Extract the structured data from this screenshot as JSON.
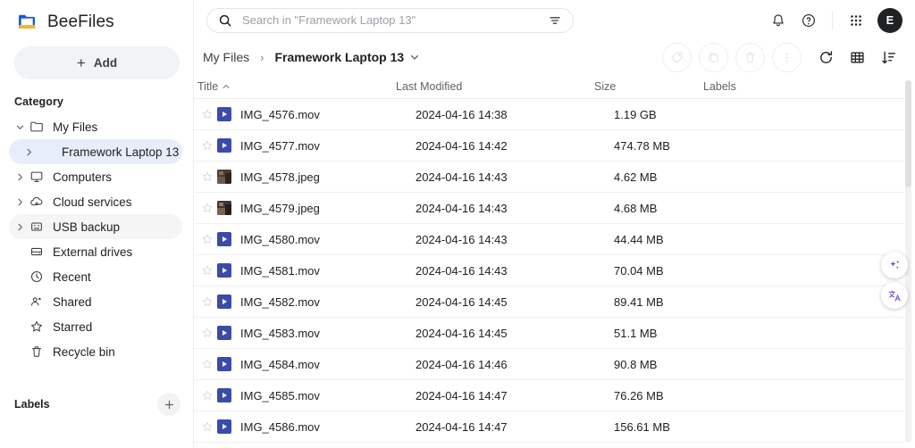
{
  "app": {
    "name": "BeeFiles",
    "logo_icon": "folder-logo-icon"
  },
  "sidebar": {
    "add_button": {
      "label": "Add",
      "icon": "plus-icon"
    },
    "category_title": "Category",
    "items": [
      {
        "label": "My Files",
        "icon": "folder-icon",
        "caret": "chevron-down-icon",
        "state": "expanded"
      },
      {
        "label": "Framework Laptop 13",
        "icon": "",
        "caret": "chevron-right-icon",
        "state": "selected"
      },
      {
        "label": "Computers",
        "icon": "monitor-icon",
        "caret": "chevron-right-icon",
        "state": "normal"
      },
      {
        "label": "Cloud services",
        "icon": "cloud-icon",
        "caret": "chevron-right-icon",
        "state": "normal"
      },
      {
        "label": "USB backup",
        "icon": "usb-drive-icon",
        "caret": "chevron-right-icon",
        "state": "hovered"
      },
      {
        "label": "External drives",
        "icon": "hard-drive-icon",
        "caret": "",
        "state": "normal"
      },
      {
        "label": "Recent",
        "icon": "clock-icon",
        "caret": "",
        "state": "normal"
      },
      {
        "label": "Shared",
        "icon": "people-icon",
        "caret": "",
        "state": "normal"
      },
      {
        "label": "Starred",
        "icon": "star-icon",
        "caret": "",
        "state": "normal"
      },
      {
        "label": "Recycle bin",
        "icon": "trash-icon",
        "caret": "",
        "state": "normal"
      }
    ],
    "labels_title": "Labels",
    "labels_add_icon": "plus-icon"
  },
  "search": {
    "placeholder": "Search in \"Framework Laptop 13\"",
    "value": "",
    "search_icon": "search-icon",
    "filter_icon": "filter-tune-icon"
  },
  "topbar": {
    "notifications_icon": "bell-icon",
    "help_icon": "help-circle-icon",
    "apps_icon": "apps-grid-icon",
    "avatar_initial": "E"
  },
  "breadcrumb": {
    "root": "My Files",
    "separator": "›",
    "current": "Framework Laptop 13",
    "dropdown_icon": "chevron-down-icon"
  },
  "toolbar": {
    "disabled_actions": [
      {
        "name": "tag-button",
        "icon": "tag-icon"
      },
      {
        "name": "copy-button",
        "icon": "copy-icon"
      },
      {
        "name": "delete-button",
        "icon": "trash-icon"
      },
      {
        "name": "more-button",
        "icon": "more-vertical-icon"
      }
    ],
    "active_actions": [
      {
        "name": "refresh-button",
        "icon": "refresh-icon"
      },
      {
        "name": "grid-view-button",
        "icon": "grid-view-icon"
      },
      {
        "name": "sort-button",
        "icon": "sort-desc-icon"
      }
    ]
  },
  "table": {
    "columns": [
      {
        "label": "Title",
        "sort": "ascending"
      },
      {
        "label": "Last Modified",
        "sort": ""
      },
      {
        "label": "Size",
        "sort": ""
      },
      {
        "label": "Labels",
        "sort": ""
      }
    ],
    "rows": [
      {
        "name": "IMG_4576.mov",
        "modified": "2024-04-16 14:38",
        "size": "1.19 GB",
        "labels": "",
        "type": "video",
        "starred": false
      },
      {
        "name": "IMG_4577.mov",
        "modified": "2024-04-16 14:42",
        "size": "474.78 MB",
        "labels": "",
        "type": "video",
        "starred": false
      },
      {
        "name": "IMG_4578.jpeg",
        "modified": "2024-04-16 14:43",
        "size": "4.62 MB",
        "labels": "",
        "type": "image",
        "starred": false
      },
      {
        "name": "IMG_4579.jpeg",
        "modified": "2024-04-16 14:43",
        "size": "4.68 MB",
        "labels": "",
        "type": "image",
        "starred": false
      },
      {
        "name": "IMG_4580.mov",
        "modified": "2024-04-16 14:43",
        "size": "44.44 MB",
        "labels": "",
        "type": "video",
        "starred": false
      },
      {
        "name": "IMG_4581.mov",
        "modified": "2024-04-16 14:43",
        "size": "70.04 MB",
        "labels": "",
        "type": "video",
        "starred": false
      },
      {
        "name": "IMG_4582.mov",
        "modified": "2024-04-16 14:45",
        "size": "89.41 MB",
        "labels": "",
        "type": "video",
        "starred": false
      },
      {
        "name": "IMG_4583.mov",
        "modified": "2024-04-16 14:45",
        "size": "51.1 MB",
        "labels": "",
        "type": "video",
        "starred": false
      },
      {
        "name": "IMG_4584.mov",
        "modified": "2024-04-16 14:46",
        "size": "90.8 MB",
        "labels": "",
        "type": "video",
        "starred": false
      },
      {
        "name": "IMG_4585.mov",
        "modified": "2024-04-16 14:47",
        "size": "76.26 MB",
        "labels": "",
        "type": "video",
        "starred": false
      },
      {
        "name": "IMG_4586.mov",
        "modified": "2024-04-16 14:47",
        "size": "156.61 MB",
        "labels": "",
        "type": "video",
        "starred": false
      }
    ]
  },
  "floating": {
    "ai_icon": "sparkle-ai-icon",
    "translate_icon": "translate-icon",
    "translate_glyph": "文A"
  },
  "colors": {
    "accent_blue": "#3b4ba8",
    "selected_nav": "#e8eef9",
    "purple": "#7b4fc4",
    "avatar_bg": "#202124"
  }
}
